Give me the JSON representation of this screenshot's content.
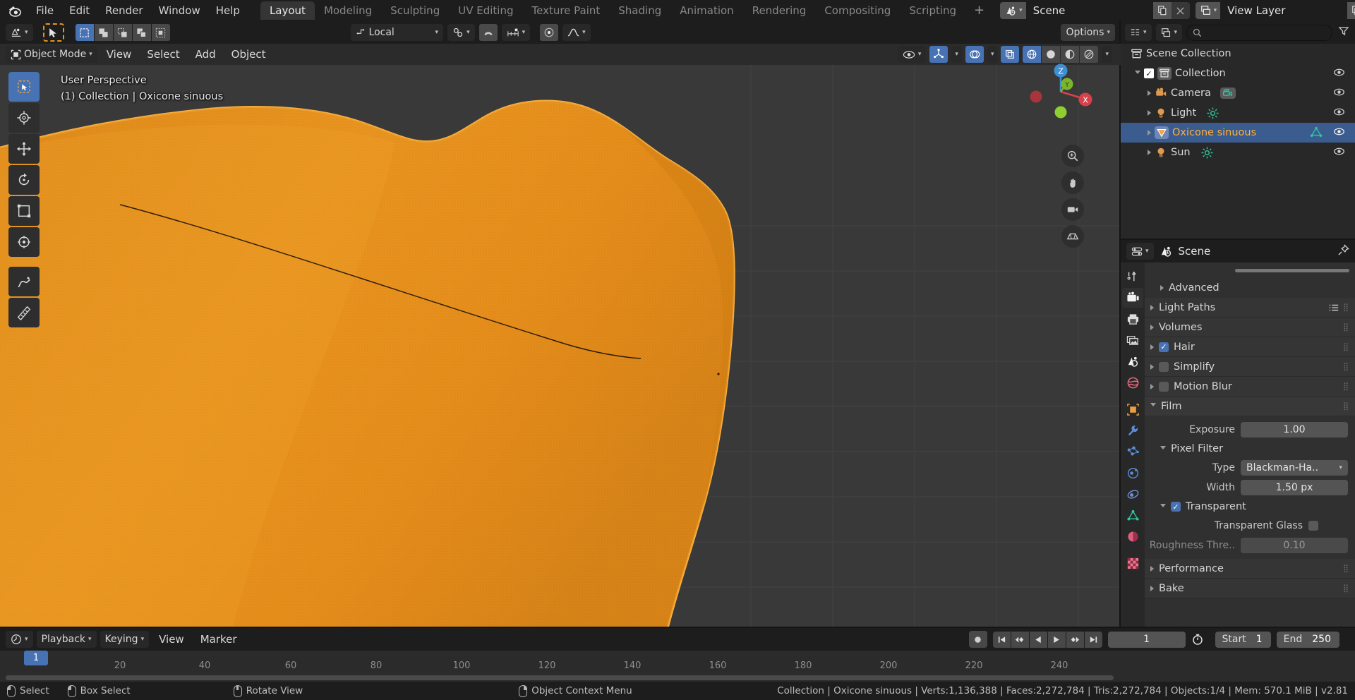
{
  "topbar": {
    "logo_icon": "blender-logo-icon",
    "menus": [
      "File",
      "Edit",
      "Render",
      "Window",
      "Help"
    ],
    "workspaces": [
      {
        "label": "Layout",
        "active": true
      },
      {
        "label": "Modeling",
        "active": false
      },
      {
        "label": "Sculpting",
        "active": false
      },
      {
        "label": "UV Editing",
        "active": false
      },
      {
        "label": "Texture Paint",
        "active": false
      },
      {
        "label": "Shading",
        "active": false
      },
      {
        "label": "Animation",
        "active": false
      },
      {
        "label": "Rendering",
        "active": false
      },
      {
        "label": "Compositing",
        "active": false
      },
      {
        "label": "Scripting",
        "active": false
      }
    ],
    "add_workspace_label": "+",
    "scene_name": "Scene",
    "scene_icon": "scene-icon",
    "scene_copy_icon": "duplicate-icon",
    "scene_close_icon": "close-icon",
    "view_layer_name": "View Layer",
    "view_layer_icon": "view-layer-icon",
    "view_layer_copy_icon": "duplicate-icon",
    "view_layer_close_icon": "close-icon"
  },
  "viewport": {
    "header": {
      "editor_type_icon": "editor-type-3dview-icon",
      "cursor_tool_icon": "tweak-cursor-icon",
      "select_modes": [
        "select-box-icon",
        "select-extend-icon",
        "select-subtract-icon",
        "select-difference-icon",
        "select-intersect-icon"
      ],
      "transform_orientation": "Local",
      "transform_orientation_icon": "orientation-icon",
      "snap_icon": "magnet-icon",
      "snap_target_icon": "snap-increment-icon",
      "proportional_icon": "proportional-edit-icon",
      "falloff_icon": "smooth-falloff-icon",
      "pivot_icon": "pivot-icon",
      "options_label": "Options"
    },
    "subheader": {
      "mode": "Object Mode",
      "mode_icon": "object-mode-icon",
      "menus": [
        "View",
        "Select",
        "Add",
        "Object"
      ],
      "visibility_icon": "show-hide-icon",
      "gizmo_icon": "gizmo-icon",
      "overlays_icon": "overlays-icon",
      "xray_icon": "xray-icon",
      "shading_modes": [
        "wireframe-icon",
        "solid-icon",
        "material-preview-icon",
        "rendered-icon"
      ]
    },
    "overlay_text_line1": "User Perspective",
    "overlay_text_line2": "(1) Collection | Oxicone sinuous",
    "tools": [
      "tweak-tool-icon",
      "cursor-tool-icon",
      "move-tool-icon",
      "rotate-tool-icon",
      "scale-tool-icon",
      "transform-tool-icon",
      "annotate-tool-icon",
      "measure-tool-icon"
    ],
    "gizmo_axes": [
      "Z",
      "Y",
      "X"
    ],
    "nav_buttons": [
      "zoom-icon",
      "pan-hand-icon",
      "camera-view-icon",
      "toggle-perspective-icon"
    ],
    "object_color": "#e8921f",
    "object_outline_color": "#f5a623",
    "background_color": "#393939"
  },
  "outliner": {
    "editor_icon": "editor-type-outliner-icon",
    "display_mode_icon": "view-layer-icon",
    "search_placeholder": "",
    "search_icon": "search-icon",
    "filter_icon": "filter-icon",
    "rows": [
      {
        "label": "Scene Collection",
        "icon": "collection-icon",
        "indent": 0,
        "selected": false,
        "has_expand": false,
        "has_checkbox": false,
        "has_eye": false,
        "type_icon": ""
      },
      {
        "label": "Collection",
        "icon": "collection-icon",
        "indent": 1,
        "selected": false,
        "has_expand": true,
        "expanded": true,
        "has_checkbox": true,
        "has_eye": true,
        "type_icon": ""
      },
      {
        "label": "Camera",
        "icon": "camera-object-icon",
        "indent": 2,
        "selected": false,
        "has_expand": true,
        "expanded": false,
        "has_checkbox": false,
        "has_eye": true,
        "type_icon": "camera-data-icon"
      },
      {
        "label": "Light",
        "icon": "light-object-icon",
        "indent": 2,
        "selected": false,
        "has_expand": true,
        "expanded": false,
        "has_checkbox": false,
        "has_eye": true,
        "type_icon": "light-data-icon"
      },
      {
        "label": "Oxicone sinuous",
        "icon": "mesh-object-icon",
        "indent": 2,
        "selected": true,
        "has_expand": true,
        "expanded": false,
        "has_checkbox": false,
        "has_eye": true,
        "type_icon": "mesh-data-icon"
      },
      {
        "label": "Sun",
        "icon": "light-object-icon",
        "indent": 2,
        "selected": false,
        "has_expand": true,
        "expanded": false,
        "has_checkbox": false,
        "has_eye": true,
        "type_icon": "light-data-icon"
      }
    ]
  },
  "properties": {
    "editor_icon": "editor-type-properties-icon",
    "context_icon": "scene-properties-icon",
    "context_name": "Scene",
    "pin_icon": "pin-icon",
    "tabs": [
      {
        "name": "tool-tab",
        "icon": "tool-icon",
        "active": false
      },
      {
        "name": "render-tab",
        "icon": "render-camera-icon",
        "active": true
      },
      {
        "name": "output-tab",
        "icon": "printer-icon",
        "active": false
      },
      {
        "name": "view-layer-tab",
        "icon": "images-icon",
        "active": false
      },
      {
        "name": "scene-tab",
        "icon": "scene-cone-icon",
        "active": false
      },
      {
        "name": "world-tab",
        "icon": "world-globe-icon",
        "active": false
      },
      {
        "name": "object-tab",
        "icon": "object-square-icon",
        "active": false
      },
      {
        "name": "modifier-tab",
        "icon": "wrench-icon",
        "active": false
      },
      {
        "name": "particles-tab",
        "icon": "particles-icon",
        "active": false
      },
      {
        "name": "physics-tab",
        "icon": "physics-orbit-icon",
        "active": false
      },
      {
        "name": "constraints-tab",
        "icon": "constraint-icon",
        "active": false
      },
      {
        "name": "data-tab",
        "icon": "mesh-data-triangle-icon",
        "active": false
      },
      {
        "name": "material-tab",
        "icon": "material-sphere-icon",
        "active": false
      },
      {
        "name": "texture-tab",
        "icon": "texture-checker-icon",
        "active": false
      }
    ],
    "panels": [
      {
        "label": "Advanced",
        "expanded": false,
        "indent": 1,
        "checkbox": null,
        "extra_icon": null
      },
      {
        "label": "Light Paths",
        "expanded": false,
        "indent": 0,
        "checkbox": null,
        "extra_icon": "preset-list-icon"
      },
      {
        "label": "Volumes",
        "expanded": false,
        "indent": 0,
        "checkbox": null,
        "extra_icon": null
      },
      {
        "label": "Hair",
        "expanded": false,
        "indent": 0,
        "checkbox": true,
        "extra_icon": null
      },
      {
        "label": "Simplify",
        "expanded": false,
        "indent": 0,
        "checkbox": false,
        "extra_icon": null
      },
      {
        "label": "Motion Blur",
        "expanded": false,
        "indent": 0,
        "checkbox": false,
        "extra_icon": null
      },
      {
        "label": "Film",
        "expanded": true,
        "indent": 0,
        "checkbox": null,
        "extra_icon": null
      }
    ],
    "film": {
      "exposure_label": "Exposure",
      "exposure_value": "1.00",
      "pixel_filter_label": "Pixel Filter",
      "type_label": "Type",
      "type_value": "Blackman-Ha..",
      "width_label": "Width",
      "width_value": "1.50 px",
      "transparent_label": "Transparent",
      "transparent_checked": true,
      "transparent_glass_label": "Transparent Glass",
      "transparent_glass_checked": false,
      "roughness_label": "Roughness Thre..",
      "roughness_value": "0.10"
    },
    "bottom_panels": [
      {
        "label": "Performance",
        "expanded": false
      },
      {
        "label": "Bake",
        "expanded": false
      }
    ]
  },
  "timeline": {
    "editor_icon": "editor-type-timeline-icon",
    "menus": [
      {
        "label": "Playback",
        "has_arrow": true
      },
      {
        "label": "Keying",
        "has_arrow": true
      },
      {
        "label": "View",
        "has_arrow": false
      },
      {
        "label": "Marker",
        "has_arrow": false
      }
    ],
    "record_icon": "auto-keying-record-icon",
    "transport_icons": [
      "jump-start-icon",
      "prev-keyframe-icon",
      "play-reverse-icon",
      "play-icon",
      "next-keyframe-icon",
      "jump-end-icon"
    ],
    "current_frame": "1",
    "timer_icon": "use-preview-range-icon",
    "start_label": "Start",
    "start_value": "1",
    "end_label": "End",
    "end_value": "250",
    "playhead_frame": "1",
    "ticks": [
      20,
      40,
      60,
      80,
      100,
      120,
      140,
      160,
      180,
      200,
      220,
      240
    ]
  },
  "statusbar": {
    "keymap": [
      {
        "icon": "mouse-left-icon",
        "label": "Select"
      },
      {
        "icon": "mouse-left-drag-icon",
        "label": "Box Select"
      },
      {
        "icon": "mouse-middle-icon",
        "label": "Rotate View"
      },
      {
        "icon": "mouse-right-icon",
        "label": "Object Context Menu"
      }
    ],
    "stats": "Collection | Oxicone sinuous | Verts:1,136,388 | Faces:2,272,784 | Tris:2,272,784 | Objects:1/4 | Mem: 570.1 MiB | v2.81"
  },
  "theme": {
    "accent_blue": "#4772b3",
    "header_bg": "#1d1d1d",
    "panel_bg": "#303030",
    "editor_bg": "#282828",
    "selected_orange": "#ffb13b"
  }
}
